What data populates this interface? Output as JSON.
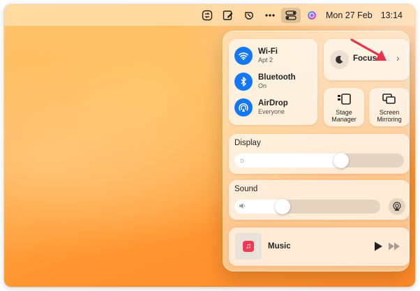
{
  "menubar": {
    "date": "Mon 27 Feb",
    "time": "13:14",
    "icons": [
      "screen-record-icon",
      "note-edit-icon",
      "cursor-app-icon",
      "more-dots-icon",
      "control-center-icon",
      "siri-icon"
    ]
  },
  "control_center": {
    "network": {
      "wifi": {
        "title": "Wi-Fi",
        "subtitle": "Apt 2",
        "icon": "wifi-icon"
      },
      "bluetooth": {
        "title": "Bluetooth",
        "subtitle": "On",
        "icon": "bluetooth-icon"
      },
      "airdrop": {
        "title": "AirDrop",
        "subtitle": "Everyone",
        "icon": "airdrop-icon"
      }
    },
    "focus": {
      "label": "Focus",
      "chevron": "›",
      "icon": "moon-icon"
    },
    "stage_manager": {
      "label_line1": "Stage",
      "label_line2": "Manager",
      "icon": "stage-manager-icon"
    },
    "screen_mirroring": {
      "label_line1": "Screen",
      "label_line2": "Mirroring",
      "icon": "screen-mirroring-icon"
    },
    "display": {
      "title": "Display",
      "level": 0.63,
      "icon": "sun-icon"
    },
    "sound": {
      "title": "Sound",
      "level": 0.33,
      "icon": "speaker-icon"
    },
    "music": {
      "label": "Music",
      "icon": "music-note-icon"
    }
  },
  "colors": {
    "accent_blue": "#1478f6",
    "music_red": "#f23a55",
    "annotation_arrow": "#e8344a"
  }
}
